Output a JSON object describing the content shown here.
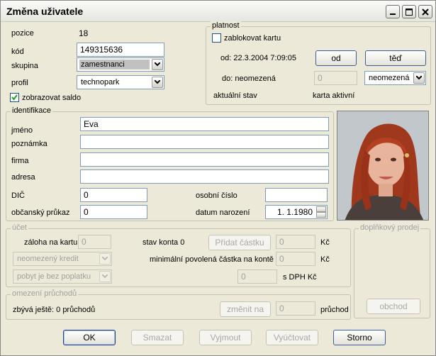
{
  "window": {
    "title": "Změna uživatele"
  },
  "fields": {
    "pozice_label": "pozice",
    "pozice_value": "18",
    "kod_label": "kód",
    "kod_value": "149315636",
    "skupina_label": "skupina",
    "skupina_value": "zamestnanci",
    "profil_label": "profil",
    "profil_value": "technopark",
    "zobrazovat_saldo_label": "zobrazovat saldo",
    "zobrazovat_saldo_checked": true
  },
  "platnost": {
    "title": "platnost",
    "zablokovat_label": "zablokovat kartu",
    "od_text": "od: 22.3.2004 7:09:05",
    "od_button": "od",
    "ted_button": "těď",
    "do_text": "do: neomezená",
    "do_value": "0",
    "do_select": "neomezená",
    "aktualni_stav_label": "aktuální stav",
    "aktualni_stav_value": "karta aktivní"
  },
  "identifikace": {
    "title": "identifikace",
    "jmeno_label": "jméno",
    "jmeno_value": "Eva",
    "poznamka_label": "poznámka",
    "poznamka_value": "",
    "firma_label": "firma",
    "firma_value": "",
    "adresa_label": "adresa",
    "adresa_value": "",
    "dic_label": "DIČ",
    "dic_value": "0",
    "osobni_cislo_label": "osobní číslo",
    "osobni_cislo_value": "",
    "obcansky_label": "občanský průkaz",
    "obcansky_value": "0",
    "datum_narozeni_label": "datum narození",
    "datum_narozeni_value": "1. 1.1980"
  },
  "ucet": {
    "title": "účet",
    "zaloha_label": "záloha na kartu",
    "zaloha_value": "0",
    "stav_konta": "stav konta 0",
    "pridat_button": "Přidat částku",
    "pridat_value": "0",
    "kc1": "Kč",
    "kredit_select": "neomezený kredit",
    "min_label": "minimální povolená částka na kontě",
    "min_value": "0",
    "kc2": "Kč",
    "pobyt_select": "pobyt je bez poplatku",
    "dph_value": "0",
    "dph_label": "s DPH Kč"
  },
  "doplnkovy": {
    "title": "doplňkový prodej",
    "obchod_button": "obchod"
  },
  "omezeni": {
    "title": "omezení průchodů",
    "zbyva_text": "zbývá ještě: 0 průchodů",
    "zmenit_button": "změnit na",
    "zmenit_value": "0",
    "pruchod_label": "průchod"
  },
  "footer": {
    "ok": "OK",
    "smazat": "Smazat",
    "vyjmout": "Vyjmout",
    "vyuctovat": "Vyúčtovat",
    "storno": "Storno"
  },
  "colors": {
    "background": "#ece9d8",
    "input_border": "#7f9db9",
    "button_border": "#3b5e9a",
    "disabled_text": "#a0a0a0"
  }
}
